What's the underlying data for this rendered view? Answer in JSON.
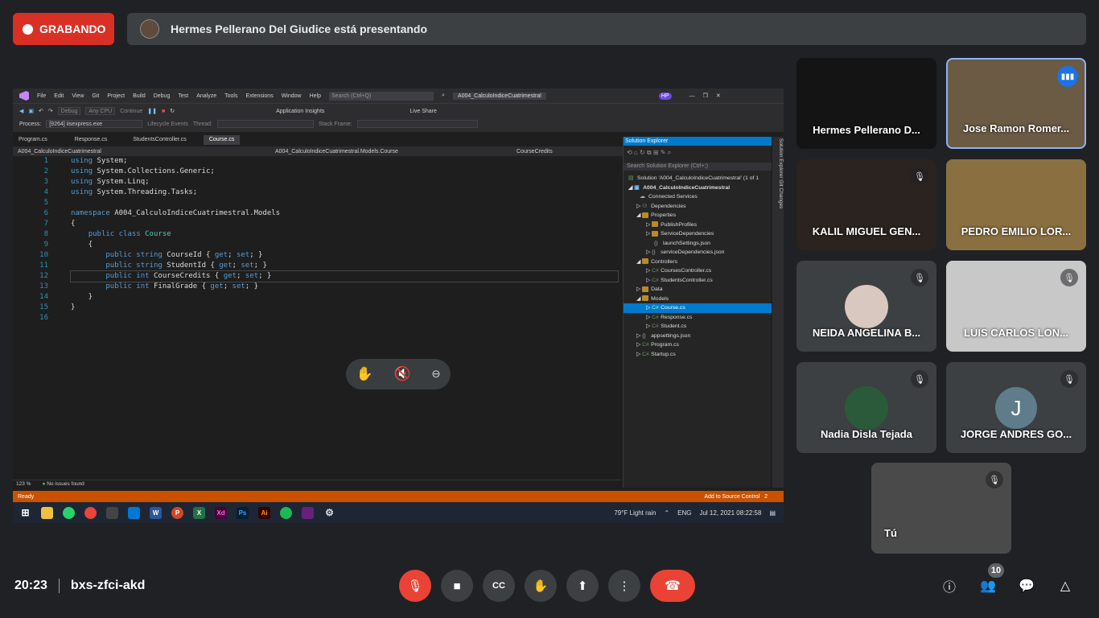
{
  "recording": {
    "label": "GRABANDO"
  },
  "presenter_bar": {
    "text": "Hermes Pellerano Del Giudice está presentando"
  },
  "vs": {
    "menus": [
      "File",
      "Edit",
      "View",
      "Git",
      "Project",
      "Build",
      "Debug",
      "Test",
      "Analyze",
      "Tools",
      "Extensions",
      "Window",
      "Help"
    ],
    "search_placeholder": "Search (Ctrl+Q)",
    "solution_title": "A004_CalculoIndiceCuatrimestral",
    "user_initials": "HP",
    "toolbar": {
      "debug": "Debug",
      "cpu": "Any CPU",
      "continue": "Continue",
      "app_insights": "Application Insights",
      "live_share": "Live Share",
      "process_label": "Process:",
      "process_value": "[9264] iisexpress.exe",
      "lifecycle": "Lifecycle Events",
      "thread": "Thread:",
      "stack_frame": "Stack Frame:"
    },
    "tabs": [
      "Program.cs",
      "Response.cs",
      "StudentsController.cs",
      "Course.cs"
    ],
    "nav": {
      "project": "A004_CalculoIndiceCuatrimestral",
      "class": "A004_CalculoIndiceCuatrimestral.Models.Course",
      "member": "CourseCredits"
    },
    "line_numbers": [
      "1",
      "2",
      "3",
      "4",
      "5",
      "6",
      "7",
      "8",
      "9",
      "10",
      "11",
      "12",
      "13",
      "14",
      "15",
      "16"
    ],
    "code_lines": [
      "using System;",
      "using System.Collections.Generic;",
      "using System.Linq;",
      "using System.Threading.Tasks;",
      "",
      "namespace A004_CalculoIndiceCuatrimestral.Models",
      "{",
      "    public class Course",
      "    {",
      "        public string CourseId { get; set; }",
      "        public string StudentId { get; set; }",
      "        public int CourseCredits { get; set; }",
      "        public int FinalGrade { get; set; }",
      "    }",
      "}",
      ""
    ],
    "zoom": "123 %",
    "issues": "No issues found",
    "solution_explorer": {
      "title": "Solution Explorer",
      "search_placeholder": "Search Solution Explorer (Ctrl+;)",
      "items": [
        "Solution 'A004_CalculoIndiceCuatrimestral' (1 of 1",
        "A004_CalculoIndiceCuatrimestral",
        "Connected Services",
        "Dependencies",
        "Properties",
        "PublishProfiles",
        "ServiceDependencies",
        "launchSettings.json",
        "serviceDependencies.json",
        "Controllers",
        "CoursesController.cs",
        "StudentsController.cs",
        "Data",
        "Models",
        "Course.cs",
        "Response.cs",
        "Student.cs",
        "appsettings.json",
        "Program.cs",
        "Startup.cs"
      ],
      "side_tabs": "Solution Explorer  Git Changes"
    },
    "status": {
      "ready": "Ready",
      "source_control": "Add to Source Control",
      "notifications": "2"
    },
    "taskbar": {
      "weather": "79°F  Light rain",
      "lang": "ENG",
      "datetime": "Jul 12, 2021 08:22:58"
    }
  },
  "participants": [
    {
      "name": "Hermes Pellerano D...",
      "muted": false
    },
    {
      "name": "Jose Ramon Romer...",
      "speaking": true
    },
    {
      "name": "KALIL MIGUEL GEN...",
      "muted": true
    },
    {
      "name": "PEDRO EMILIO LOR...",
      "muted": true
    },
    {
      "name": "NEIDA ANGELINA B...",
      "muted": true
    },
    {
      "name": "LUIS CARLOS LON...",
      "muted": true
    },
    {
      "name": "Nadia Disla Tejada",
      "muted": true
    },
    {
      "name": "JORGE ANDRES GO...",
      "muted": true,
      "initial": "J"
    },
    {
      "name": "Tú",
      "muted": true
    }
  ],
  "meeting": {
    "time": "20:23",
    "code": "bxs-zfci-akd",
    "participant_count": "10"
  },
  "colors": {
    "end_call": "#ea4335",
    "record": "#d93025",
    "speaking": "#1a73e8",
    "tile": "#3c4043"
  }
}
